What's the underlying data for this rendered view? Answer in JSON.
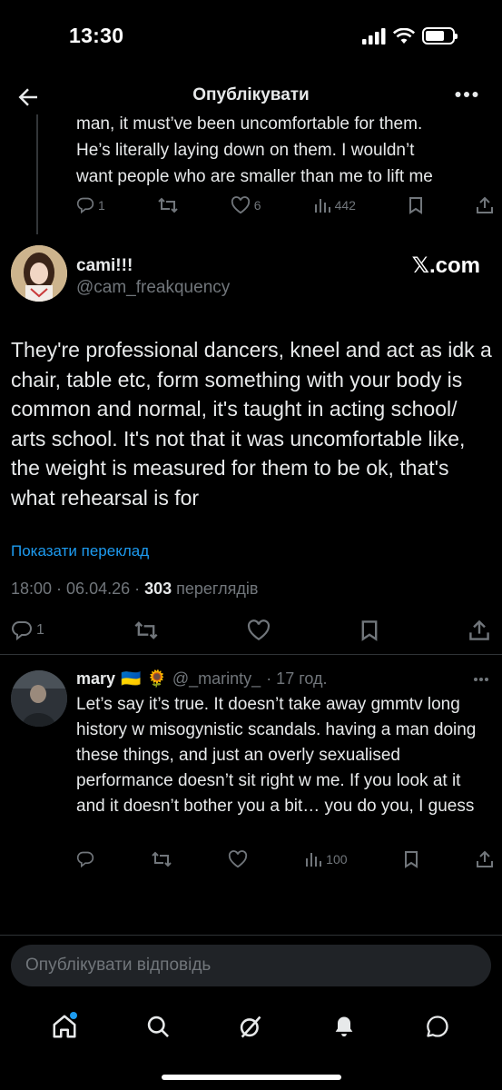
{
  "status_bar": {
    "time": "13:30"
  },
  "header": {
    "title": "Опублікувати"
  },
  "parent_tweet": {
    "text_lines": [
      "man, it must’ve been uncomfortable for them.",
      "He’s literally laying down on them. I wouldn’t",
      "want people who are smaller than me to lift me"
    ],
    "replies": "1",
    "likes": "6",
    "views": "442"
  },
  "main_tweet": {
    "display_name": "cami!!!",
    "handle": "@cam_freakquency",
    "source_logo": "𝕏.com",
    "text": "They're professional dancers, kneel and act as idk a chair, table etc, form something with your body is common and normal, it's taught in acting school/ arts school. It's not that it was uncomfortable like, the weight is measured for them to be ok, that's what rehearsal is for",
    "translate_label": "Показати переклад",
    "timestamp": "18:00 · 06.04.26 · ",
    "views_count": "303",
    "views_label": " переглядів",
    "replies": "1"
  },
  "reply": {
    "display_name": "mary",
    "flag": "🇺🇦",
    "sunflower": "🌻",
    "handle": "@_marinty_",
    "time": "· 17 год.",
    "text": "Let’s say it’s true. It doesn’t take away gmmtv long history w misogynistic scandals. having a man doing these things, and just an overly sexualised performance doesn’t sit right w me. If you look at it and it doesn’t bother you a bit… you do you, I guess",
    "views": "100"
  },
  "composer": {
    "placeholder": "Опублікувати відповідь"
  },
  "colors": {
    "accent": "#1d9bf0",
    "muted": "#71767b",
    "background": "#000000"
  },
  "icons": [
    "back-arrow-icon",
    "more-icon",
    "reply-icon",
    "retweet-icon",
    "like-icon",
    "views-icon",
    "bookmark-icon",
    "share-icon",
    "home-icon",
    "search-icon",
    "grok-icon",
    "bell-icon",
    "messages-icon"
  ]
}
